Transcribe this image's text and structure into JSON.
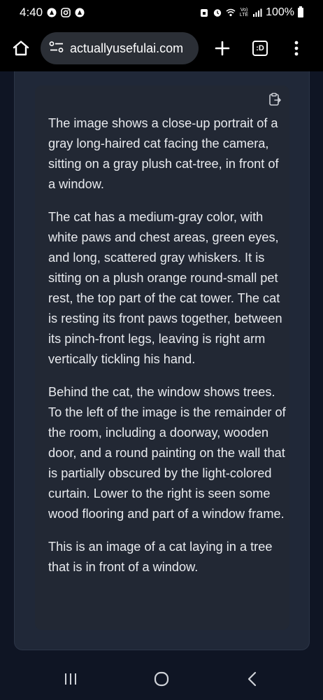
{
  "status_bar": {
    "time": "4:40",
    "battery_text": "100%",
    "network_label": "Vo) LTE"
  },
  "browser": {
    "url": "actuallyusefulai.com",
    "tabs_label": ":D",
    "icons": [
      "home-icon",
      "site-settings-icon",
      "new-tab-icon",
      "tab-switcher-icon",
      "menu-icon"
    ]
  },
  "card": {
    "paragraphs": [
      "The image shows a close-up portrait of a gray long-haired cat facing the camera, sitting on a gray plush cat-tree, in front of a window.",
      "The cat has a medium-gray color, with white paws and chest areas, green eyes, and long, scattered gray whiskers. It is sitting on a plush orange round-small pet rest, the top part of the cat tower. The cat is resting its front paws together, between its pinch-front legs, leaving is right arm vertically tickling his hand.",
      "Behind the cat, the window shows trees. To the left of the image is the remainder of the room, including a doorway, wooden door, and a round painting on the wall that is partially obscured by the light-colored curtain. Lower to the right is seen some wood flooring and part of a window frame.",
      "This is an image of a cat laying in a tree that is in front of a window."
    ]
  },
  "colors": {
    "page_bg": "#0f1524",
    "panel_bg": "#202838",
    "card_bg": "#222834",
    "toolbar_bg": "#000000",
    "url_pill_bg": "#2b2f36"
  }
}
